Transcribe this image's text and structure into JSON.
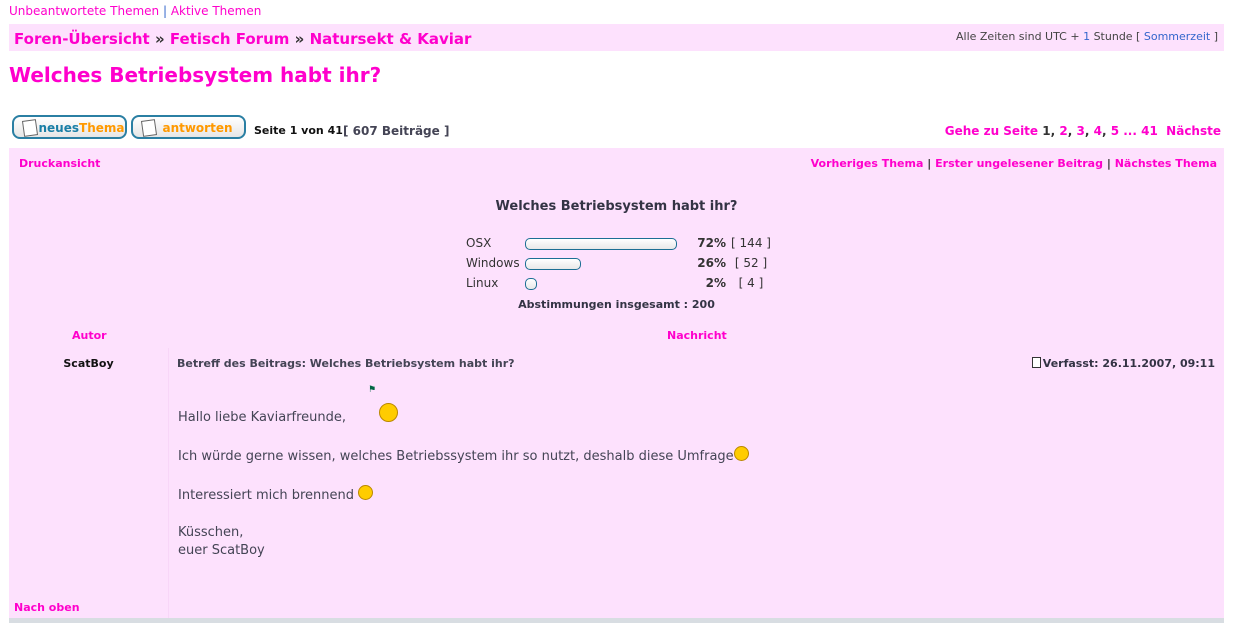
{
  "top_links": {
    "unanswered": "Unbeantwortete Themen",
    "separator": "|",
    "active": "Aktive Themen"
  },
  "breadcrumb": {
    "items": [
      "Foren-Übersicht",
      "Fetisch Forum",
      "Natursekt & Kaviar"
    ],
    "sep": "»"
  },
  "timezone": {
    "text": "Alle Zeiten sind UTC + ",
    "offset": "1",
    "unit": " Stunde [ ",
    "dst": "Sommerzeit",
    "end": " ]"
  },
  "topic_title": "Welches Betriebsystem habt ihr?",
  "buttons": {
    "new_topic_a": "neues",
    "new_topic_b": "Thema",
    "reply": "antworten"
  },
  "page_info": "Seite 1 von 41",
  "post_count": "[ 607 Beiträge ]",
  "pagination": {
    "label": "Gehe zu Seite",
    "current": "1",
    "pages": [
      "2",
      "3",
      "4",
      "5"
    ],
    "ellipsis": "...",
    "last": "41",
    "next": "Nächste"
  },
  "print": "Druckansicht",
  "topic_nav": {
    "prev": "Vorheriges Thema",
    "first_unread": "Erster ungelesener Beitrag",
    "next": "Nächstes Thema",
    "sep": "|"
  },
  "poll": {
    "question": "Welches Betriebsystem habt ihr?",
    "options": [
      {
        "label": "OSX",
        "percent": 72,
        "percent_text": "72%",
        "votes": "[ 144 ]"
      },
      {
        "label": "Windows",
        "percent": 26,
        "percent_text": "26%",
        "votes": "[ 52 ]"
      },
      {
        "label": "Linux",
        "percent": 2,
        "percent_text": "2%",
        "votes": "[ 4 ]"
      }
    ],
    "total": "Abstimmungen insgesamt : 200"
  },
  "headers": {
    "author": "Autor",
    "message": "Nachricht"
  },
  "post": {
    "author": "ScatBoy",
    "subject": "Betreff des Beitrags: Welches Betriebsystem habt ihr?",
    "posted": "Verfasst: 26.11.2007, 09:11",
    "lines": [
      "Hallo liebe Kaviarfreunde,",
      "Ich würde gerne wissen, welches Betriebssystem ihr so nutzt, deshalb diese Umfrage",
      "Interessiert mich brennend",
      "Küsschen,",
      "euer ScatBoy"
    ]
  },
  "back_to_top": "Nach oben",
  "colors": {
    "accent": "#ff00cc",
    "panel": "#fde1fd",
    "button_border": "#2a7fa3",
    "button_orange": "#f90",
    "button_blue": "#1a7fa6"
  }
}
